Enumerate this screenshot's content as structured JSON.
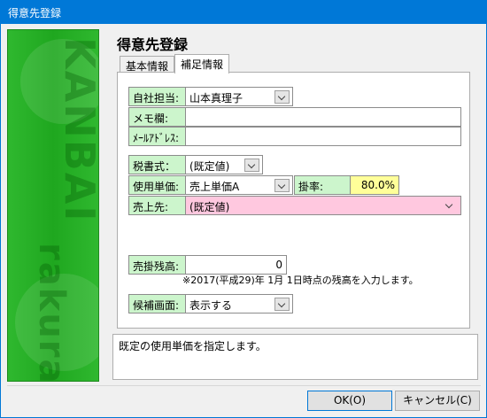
{
  "window": {
    "title": "得意先登録"
  },
  "heading": "得意先登録",
  "tabs": [
    {
      "label": "基本情報"
    },
    {
      "label": "補足情報"
    }
  ],
  "fields": {
    "jisha_tanto": {
      "label": "自社担当:",
      "value": "山本真理子"
    },
    "memo": {
      "label": "メモ欄:",
      "value": ""
    },
    "mail": {
      "label": "ﾒｰﾙｱﾄﾞﾚｽ:",
      "value": ""
    },
    "zeisho": {
      "label": "税書式：",
      "value": "(既定値)"
    },
    "shiyo_tanka": {
      "label": "使用単価:",
      "value": "売上単価A"
    },
    "kakeritsu": {
      "label": "掛率:",
      "value": "80.0%"
    },
    "uriagesaki": {
      "label": "売上先:",
      "value": "(既定値)"
    },
    "urikake_zandaka": {
      "label": "売掛残高:",
      "value": "0"
    },
    "kouho_gamen": {
      "label": "候補画面:",
      "value": "表示する"
    }
  },
  "note": "※2017(平成29)年 1月 1日時点の残高を入力します。",
  "message": "既定の使用単価を指定します。",
  "buttons": {
    "ok": "OK(O)",
    "cancel": "キャンセル(C)"
  },
  "decor": {
    "top_text": "KANBAI",
    "bottom_text": "rakuraku"
  },
  "colors": {
    "title_bar": "#0078d7",
    "label_bg": "#ccf5cc",
    "pink_field": "#ffc8df",
    "yellow_field": "#ffff99",
    "green_panel": "#2ca82c"
  }
}
